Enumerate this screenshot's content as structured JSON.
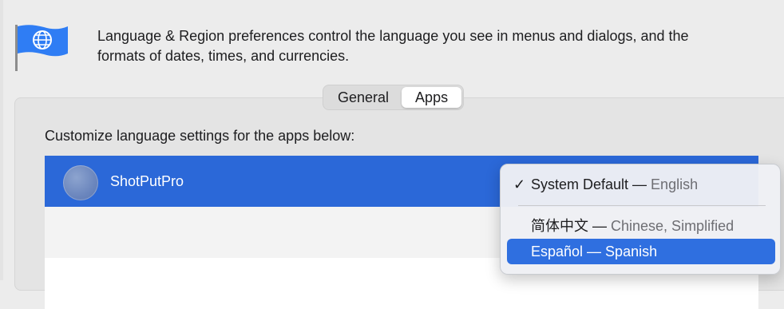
{
  "header": {
    "description_line1": "Language & Region preferences control the language you see in menus and dialogs, and the",
    "description_line2": "formats of dates, times, and currencies."
  },
  "tabs": [
    {
      "label": "General",
      "selected": false
    },
    {
      "label": "Apps",
      "selected": true
    }
  ],
  "apps_section": {
    "label": "Customize language settings for the apps below:",
    "apps": [
      {
        "name": "ShotPutPro",
        "selected": true
      }
    ]
  },
  "language_menu": {
    "items": [
      {
        "check": "✓",
        "main": "System Default — ",
        "sub": "English",
        "checked": true
      },
      {
        "main": "简体中文 — ",
        "sub": "Chinese, Simplified"
      },
      {
        "main": "Español — Spanish",
        "highlighted": true
      }
    ]
  },
  "colors": {
    "selection_blue": "#2b68d8",
    "menu_highlight": "#2f6fe0",
    "flag_blue": "#2f7df4"
  },
  "icons": {
    "flag": "globe-flag-icon",
    "app": "shotputpro-app-icon",
    "check": "checkmark-icon"
  }
}
